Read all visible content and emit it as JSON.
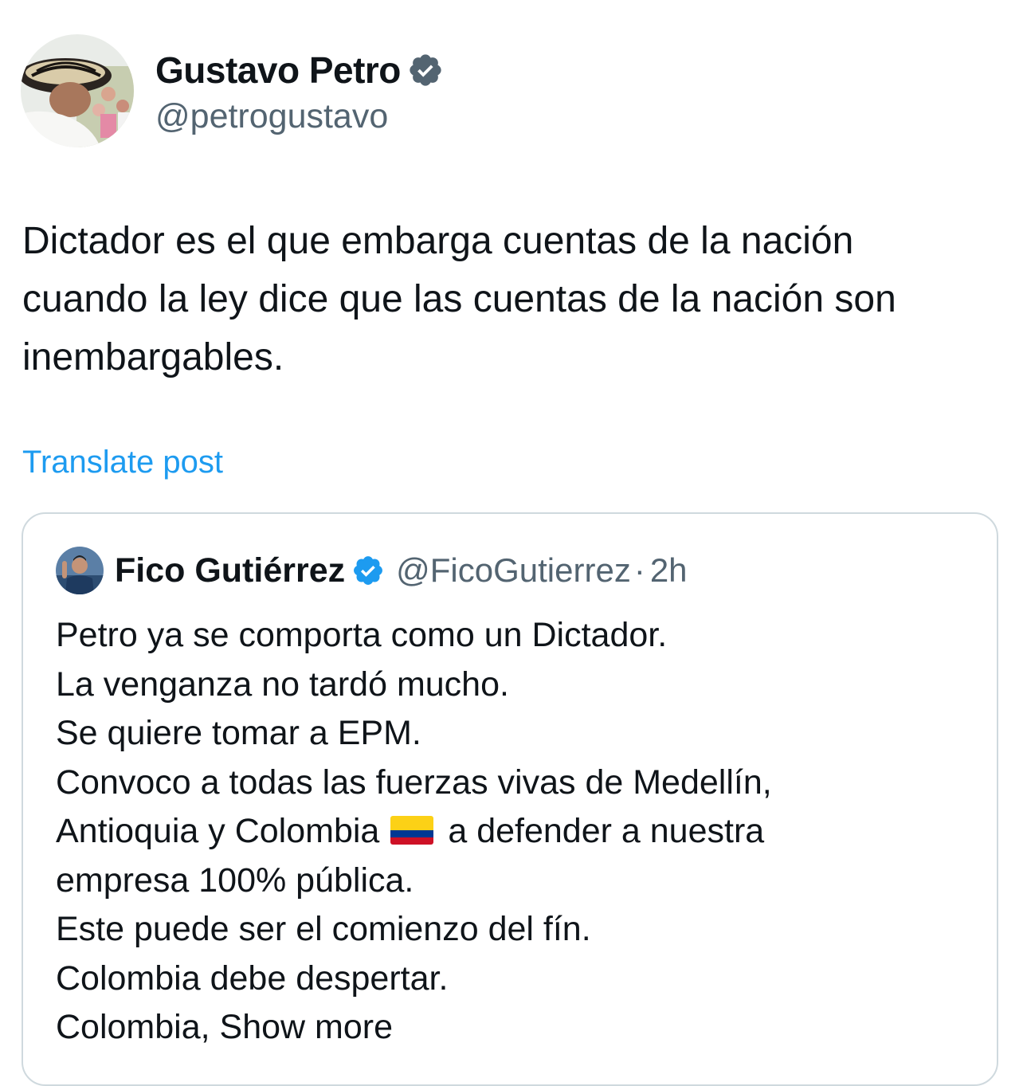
{
  "post": {
    "author_name": "Gustavo Petro",
    "author_handle": "@petrogustavo",
    "avatar_icon": "profile-photo-sombrero",
    "verified_icon": "verified-badge-icon",
    "text_lines": [
      "Dictador es el que embarga cuentas de la nación",
      "cuando la ley dice que las cuentas de la nación son",
      "inembargables."
    ],
    "translate_label": "Translate post"
  },
  "quote": {
    "author_name": "Fico Gutiérrez",
    "author_handle": "@FicoGutierrez",
    "separator": "·",
    "time": "2h",
    "lines": {
      "l1": "Petro ya se comporta como un Dictador.",
      "l2": "La venganza no tardó mucho.",
      "l3": "Se quiere tomar a EPM.",
      "l4": "Convoco a todas las fuerzas vivas de Medellín,",
      "l5a": "Antioquia y Colombia",
      "l5b": "a defender a nuestra",
      "l6": "empresa 100% pública.",
      "l7": "Este puede ser el comienzo del fín.",
      "l8": "Colombia debe despertar.",
      "l9": "Colombia,"
    },
    "show_more_label": "Show more",
    "flag_icon": "colombia-flag-emoji"
  },
  "colors": {
    "text": "#0f1419",
    "secondary": "#536471",
    "link": "#1d9bf0",
    "border": "#cfd9de",
    "verified": "#1d9bf0",
    "flag_yellow": "#fcd116",
    "flag_blue": "#003893",
    "flag_red": "#ce1126"
  }
}
